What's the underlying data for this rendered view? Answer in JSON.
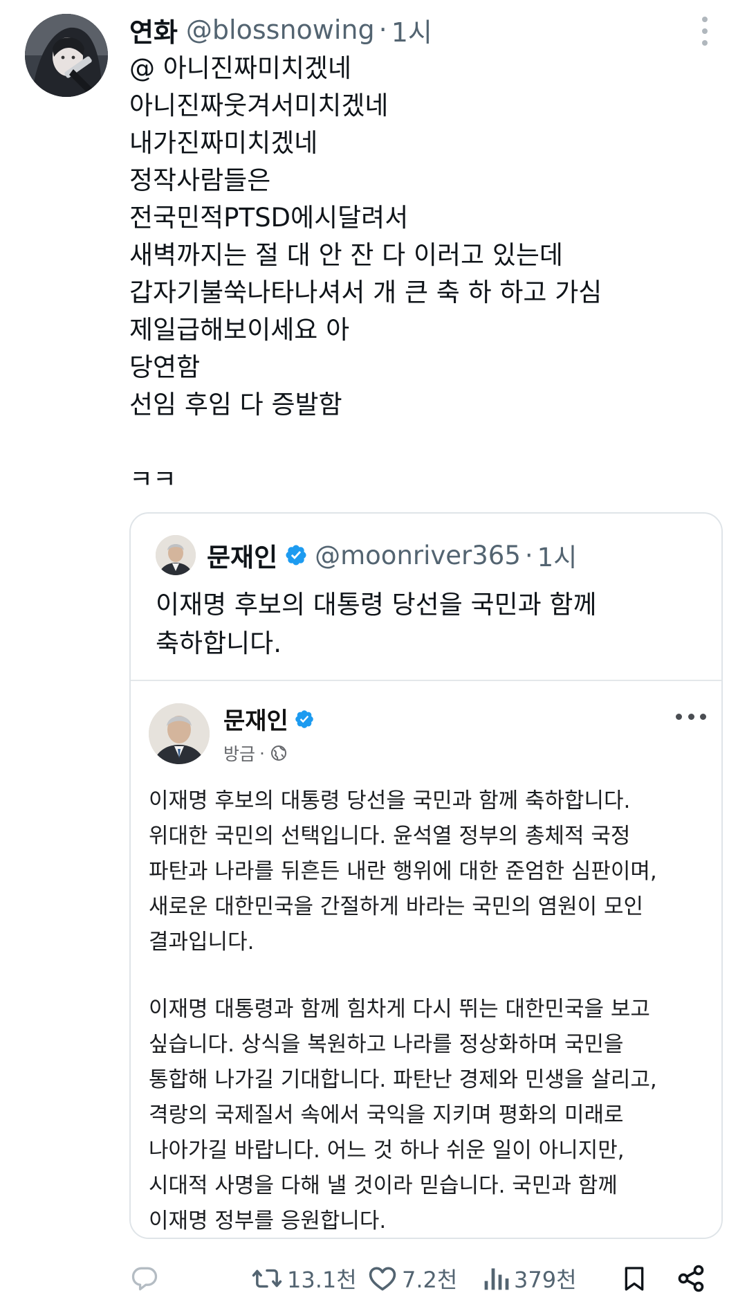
{
  "tweet": {
    "author_name": "연화",
    "author_handle": "@blossnowing",
    "separator": "·",
    "time": "1시",
    "lines": [
      "@ 아니진짜미치겠네",
      "아니진짜웃겨서미치겠네",
      "내가진짜미치겠네",
      "정작사람들은",
      "전국민적PTSD에시달려서",
      "새벽까지는 절 대 안 잔 다 이러고 있는데",
      "갑자기불쑥나타나셔서 개 큰 축 하 하고 가심",
      "제일급해보이세요 아",
      "당연함",
      "선임 후임 다 증발함",
      "",
      "ㅋㅋ"
    ]
  },
  "quote": {
    "author_name": "문재인",
    "author_handle": "@moonriver365",
    "separator": "·",
    "time": "1시",
    "text_line1": "이재명 후보의 대통령 당선을 국민과 함께",
    "text_line2": "축하합니다.",
    "facebook_post": {
      "author_name": "문재인",
      "meta_time": "방금",
      "meta_separator": "·",
      "paragraph1": [
        "이재명 후보의 대통령 당선을 국민과 함께 축하합니다.",
        "위대한 국민의 선택입니다. 윤석열 정부의 총체적 국정",
        "파탄과 나라를 뒤흔든 내란 행위에 대한 준엄한 심판이며,",
        "새로운 대한민국을 간절하게 바라는 국민의 염원이 모인",
        "결과입니다."
      ],
      "paragraph2": [
        "이재명 대통령과 함께 힘차게 다시 뛰는 대한민국을 보고",
        "싶습니다. 상식을 복원하고 나라를 정상화하며 국민을",
        "통합해 나가길 기대합니다. 파탄난 경제와 민생을 살리고,",
        "격랑의 국제질서 속에서 국익을 지키며 평화의 미래로",
        "나아가길 바랍니다. 어느 것 하나 쉬운 일이 아니지만,",
        "시대적 사명을 다해 낼 것이라 믿습니다. 국민과 함께",
        "이재명 정부를 응원합니다."
      ]
    }
  },
  "actions": {
    "retweets": "13.1천",
    "likes": "7.2천",
    "views": "379천"
  },
  "icons": {
    "more": "more-vertical-icon",
    "reply": "reply-icon",
    "retweet": "retweet-icon",
    "like": "heart-icon",
    "views": "views-icon",
    "bookmark": "bookmark-icon",
    "share": "share-icon",
    "verified": "verified-badge-icon",
    "globe": "globe-icon"
  },
  "colors": {
    "verified": "#1d9bf0",
    "secondary_text": "#536471",
    "border": "#dfe4e8"
  }
}
